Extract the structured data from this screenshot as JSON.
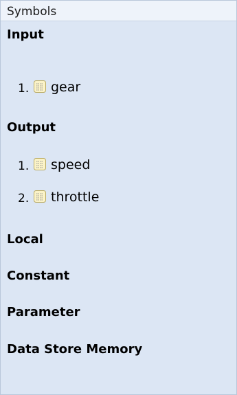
{
  "panel": {
    "title": "Symbols"
  },
  "sections": {
    "input": {
      "label": "Input",
      "items": [
        {
          "num": "1.",
          "name": "gear",
          "icon": "data-table-icon"
        }
      ]
    },
    "output": {
      "label": "Output",
      "items": [
        {
          "num": "1.",
          "name": "speed",
          "icon": "data-table-icon"
        },
        {
          "num": "2.",
          "name": "throttle",
          "icon": "data-table-icon"
        }
      ]
    },
    "local": {
      "label": "Local"
    },
    "constant": {
      "label": "Constant"
    },
    "parameter": {
      "label": "Parameter"
    },
    "data_store_memory": {
      "label": "Data Store Memory"
    }
  },
  "colors": {
    "panel_background": "#dce6f4",
    "header_background": "#eef3fa",
    "icon_fill": "#fbf3c8",
    "icon_border": "#b9aa62"
  }
}
